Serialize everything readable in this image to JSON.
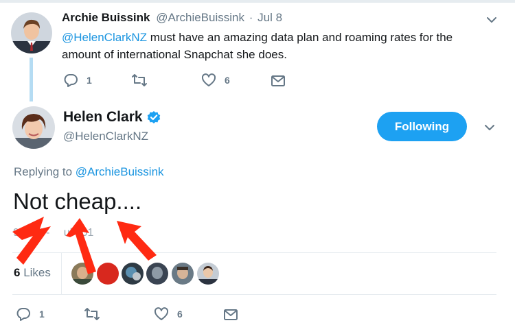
{
  "colors": {
    "accent": "#1da1f2",
    "link": "#1b95e0",
    "muted": "#657786",
    "annotation_red": "#ff2a12"
  },
  "parent_tweet": {
    "author_name": "Archie Buissink",
    "author_handle": "@ArchieBuissink",
    "separator": "·",
    "date": "Jul 8",
    "mention": "@HelenClarkNZ",
    "text": " must have an amazing data plan and roaming rates for the amount of international Snapchat she does.",
    "reply_count": "1",
    "like_count": "6",
    "icons": [
      "reply-icon",
      "retweet-icon",
      "heart-icon",
      "message-icon",
      "chevron-down-icon"
    ]
  },
  "main_tweet": {
    "author_name": "Helen Clark",
    "verified_icon": "verified-badge-icon",
    "author_handle": "@HelenClarkNZ",
    "follow_button": "Following",
    "replying_prefix": "Replying to ",
    "replying_to": "@ArchieBuissink",
    "text": "Not cheap....",
    "timestamp": "9:3 M -   ul 201",
    "likes_count": "6",
    "likes_label": " Likes",
    "reply_count": "1",
    "like_count": "6",
    "liker_avatars": 6
  },
  "annotation": {
    "description": "three-red-arrows-icon"
  }
}
